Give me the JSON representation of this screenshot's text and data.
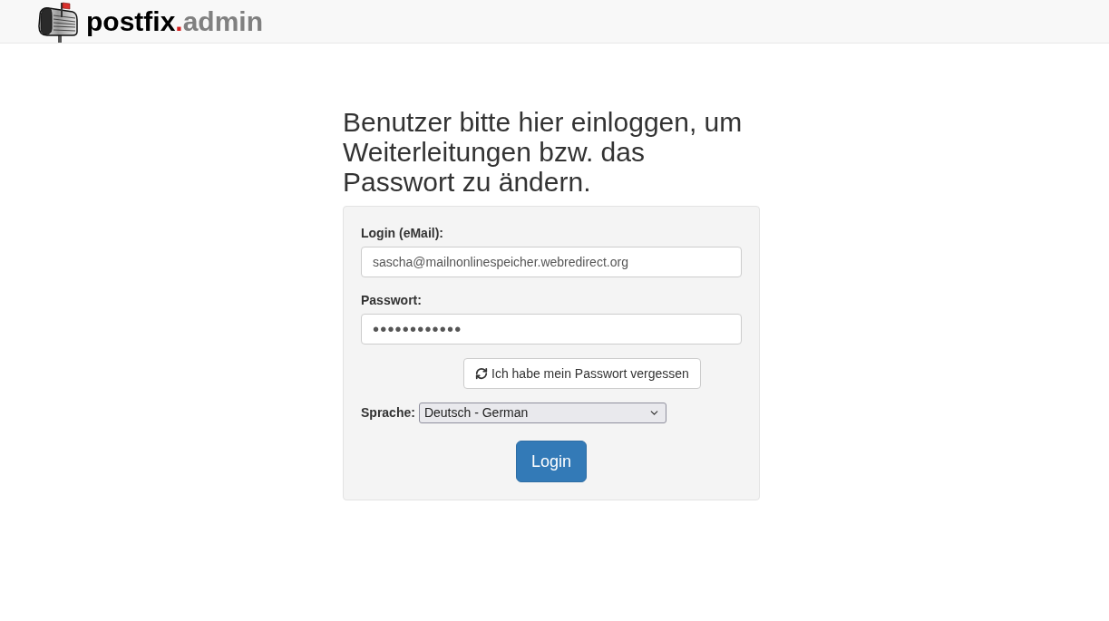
{
  "header": {
    "logo": {
      "name": "postfix",
      "dot": ".",
      "suffix": "admin"
    }
  },
  "heading": "Benutzer bitte hier einloggen, um Weiterleitungen bzw. das Passwort zu ändern.",
  "login_form": {
    "fields": [
      {
        "label": "Login (eMail):",
        "value": "sascha@mailnonlinespeicher.webredirect.org",
        "kind": "text"
      },
      {
        "label": "Passwort:",
        "value": "••••••••••••",
        "kind": "password"
      }
    ],
    "forgot_password_button": "Ich habe mein Passwort vergessen",
    "language": {
      "label": "Sprache:",
      "value": "Deutsch - German"
    },
    "submit_button": "Login"
  }
}
